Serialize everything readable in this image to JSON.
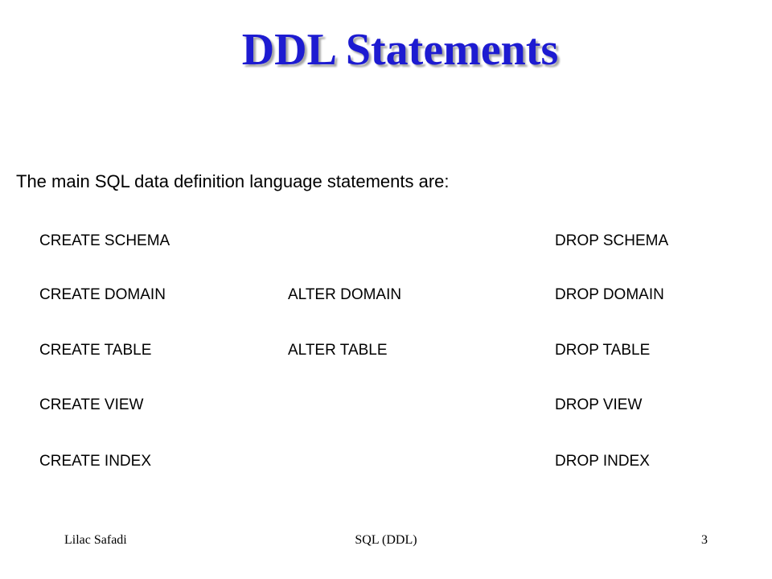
{
  "slide": {
    "title": "DDL Statements",
    "intro": "The main SQL data definition language statements are:",
    "statements": {
      "create_schema": "CREATE SCHEMA",
      "drop_schema": "DROP SCHEMA",
      "create_domain": "CREATE DOMAIN",
      "alter_domain": "ALTER DOMAIN",
      "drop_domain": "DROP DOMAIN",
      "create_table": "CREATE TABLE",
      "alter_table": "ALTER TABLE",
      "drop_table": "DROP TABLE",
      "create_view": "CREATE VIEW",
      "drop_view": "DROP VIEW",
      "create_index": "CREATE INDEX",
      "drop_index": "DROP INDEX"
    },
    "footer": {
      "author": "Lilac Safadi",
      "topic": "SQL (DDL)",
      "page_number": "3"
    },
    "colors": {
      "title": "#1d1bd1",
      "title_shadow": "#a6a6a6",
      "text": "#000000",
      "background": "#ffffff"
    }
  }
}
